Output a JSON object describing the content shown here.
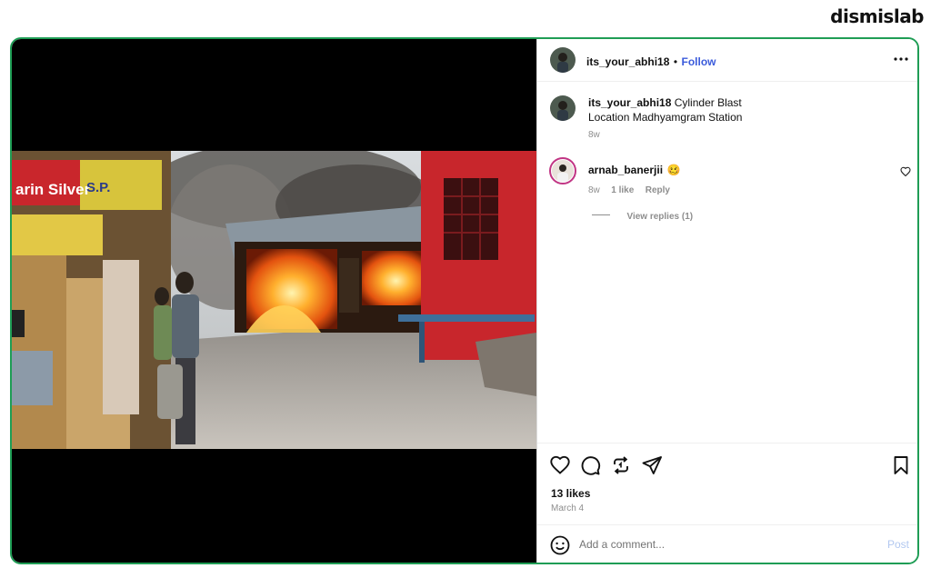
{
  "brand": {
    "logo_text": "dismislab"
  },
  "post": {
    "author": "its_your_abhi18",
    "follow_label": "Follow",
    "separator": "•",
    "caption_line1": "Cylinder Blast",
    "caption_line2": "Location Madhyamgram Station",
    "caption_age": "8w",
    "likes": "13 likes",
    "date": "March 4"
  },
  "video": {
    "sign_text_1": "arin Silver",
    "sign_text_2": "S.P.",
    "muted": true
  },
  "comments": [
    {
      "user": "arnab_banerjii",
      "emoji": "🥴",
      "age": "8w",
      "like_count": "1 like",
      "reply_label": "Reply",
      "view_replies": "View replies (1)"
    }
  ],
  "composer": {
    "placeholder": "Add a comment...",
    "post_label": "Post"
  },
  "icons": {
    "more": "more-options-icon",
    "like": "heart-icon",
    "comment": "comment-icon",
    "share": "repost-icon",
    "send": "send-icon",
    "save": "bookmark-icon",
    "emoji": "emoji-icon",
    "mute": "speaker-muted-icon",
    "comment_like": "small-heart-icon"
  },
  "colors": {
    "frame_border": "#1f9d55",
    "follow": "#3b5bdb",
    "post_disabled": "#b2c8f0",
    "commenter_ring": "#c13584"
  }
}
